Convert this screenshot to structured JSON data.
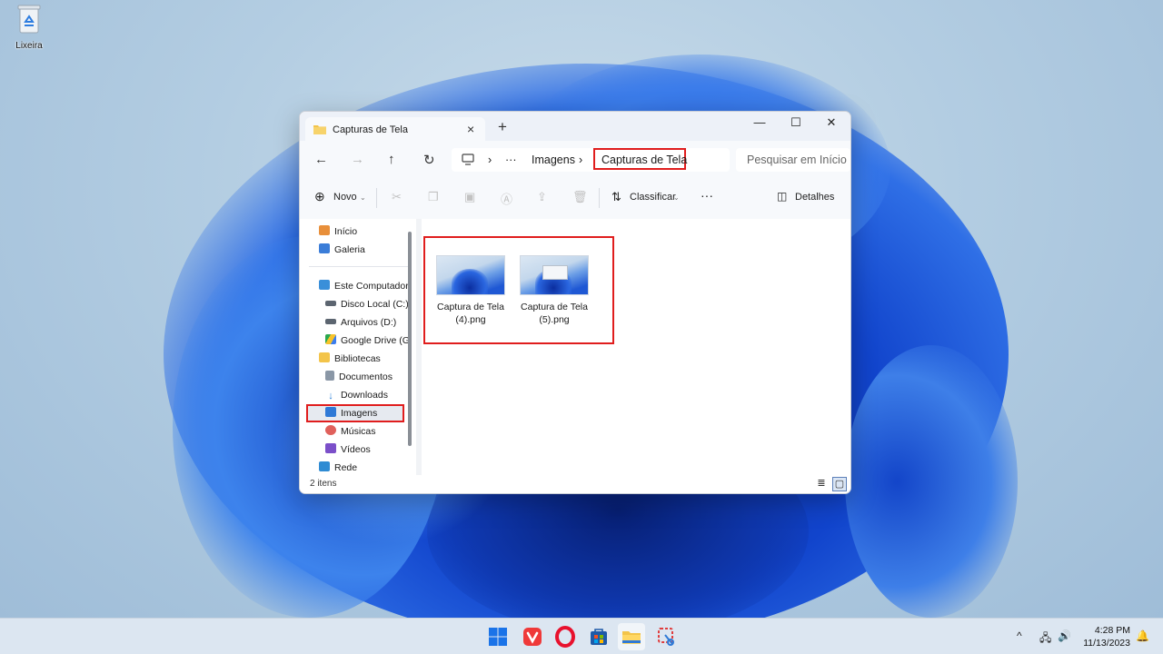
{
  "desktop": {
    "recycle_bin_label": "Lixeira"
  },
  "explorer": {
    "tab_title": "Capturas de Tela",
    "new_tab": "+",
    "window_controls": {
      "minimize": "—",
      "maximize": "☐",
      "close": "✕"
    },
    "nav": {
      "back": "←",
      "forward": "→",
      "up": "↑",
      "refresh": "↻"
    },
    "address": {
      "more": "···",
      "crumbs": [
        "Imagens",
        "Capturas de Tela"
      ],
      "separator": "›"
    },
    "search_placeholder": "Pesquisar em Início",
    "toolbar": {
      "new_label": "Novo",
      "sort_label": "Classificar",
      "more": "···",
      "details_label": "Detalhes"
    },
    "sidebar": {
      "items": [
        {
          "label": "Início",
          "icon": "home-icon"
        },
        {
          "label": "Galeria",
          "icon": "gallery-icon"
        },
        {
          "label": "Este Computador",
          "icon": "computer-icon"
        },
        {
          "label": "Disco Local (C:)",
          "icon": "drive-icon"
        },
        {
          "label": "Arquivos (D:)",
          "icon": "drive-icon"
        },
        {
          "label": "Google Drive (G",
          "icon": "google-drive-icon"
        },
        {
          "label": "Bibliotecas",
          "icon": "folder-icon"
        },
        {
          "label": "Documentos",
          "icon": "documents-icon"
        },
        {
          "label": "Downloads",
          "icon": "download-icon"
        },
        {
          "label": "Imagens",
          "icon": "pictures-icon"
        },
        {
          "label": "Músicas",
          "icon": "music-icon"
        },
        {
          "label": "Vídeos",
          "icon": "videos-icon"
        },
        {
          "label": "Rede",
          "icon": "network-icon"
        }
      ],
      "selected": "Imagens"
    },
    "files": [
      {
        "line1": "Captura de Tela",
        "line2": "(4).png"
      },
      {
        "line1": "Captura de Tela",
        "line2": "(5).png"
      }
    ],
    "status": {
      "count": "2 itens"
    }
  },
  "taskbar": {
    "apps": [
      "windows-start-icon",
      "vivaldi-icon",
      "opera-icon",
      "store-icon",
      "file-explorer-icon",
      "snipping-tool-icon"
    ],
    "time": "4:28 PM",
    "date": "11/13/2023",
    "tray_up": "^"
  },
  "colors": {
    "highlight_red": "#e01d1d",
    "accent_blue": "#1f58d4"
  }
}
